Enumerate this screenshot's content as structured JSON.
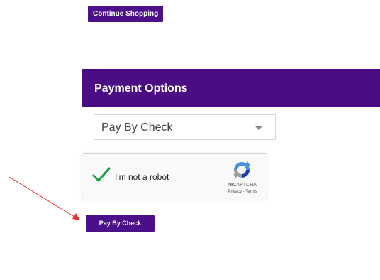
{
  "top": {
    "continue_label": "Continue Shopping"
  },
  "payment": {
    "title": "Payment Options",
    "selected_option": "Pay By Check"
  },
  "captcha": {
    "label": "I'm not a robot",
    "brand": "reCAPTCHA",
    "privacy_link": "Privacy",
    "separator": " - ",
    "terms_link": "Terms"
  },
  "actions": {
    "submit_label": "Pay By Check"
  },
  "colors": {
    "brand_purple": "#4b0d83",
    "check_green": "#1e9e42",
    "annotation_red": "#e53030"
  },
  "icons": {
    "dropdown": "chevron-down-icon",
    "check": "checkmark-icon",
    "captcha": "recaptcha-logo-icon",
    "annotation": "red-arrow-icon"
  }
}
